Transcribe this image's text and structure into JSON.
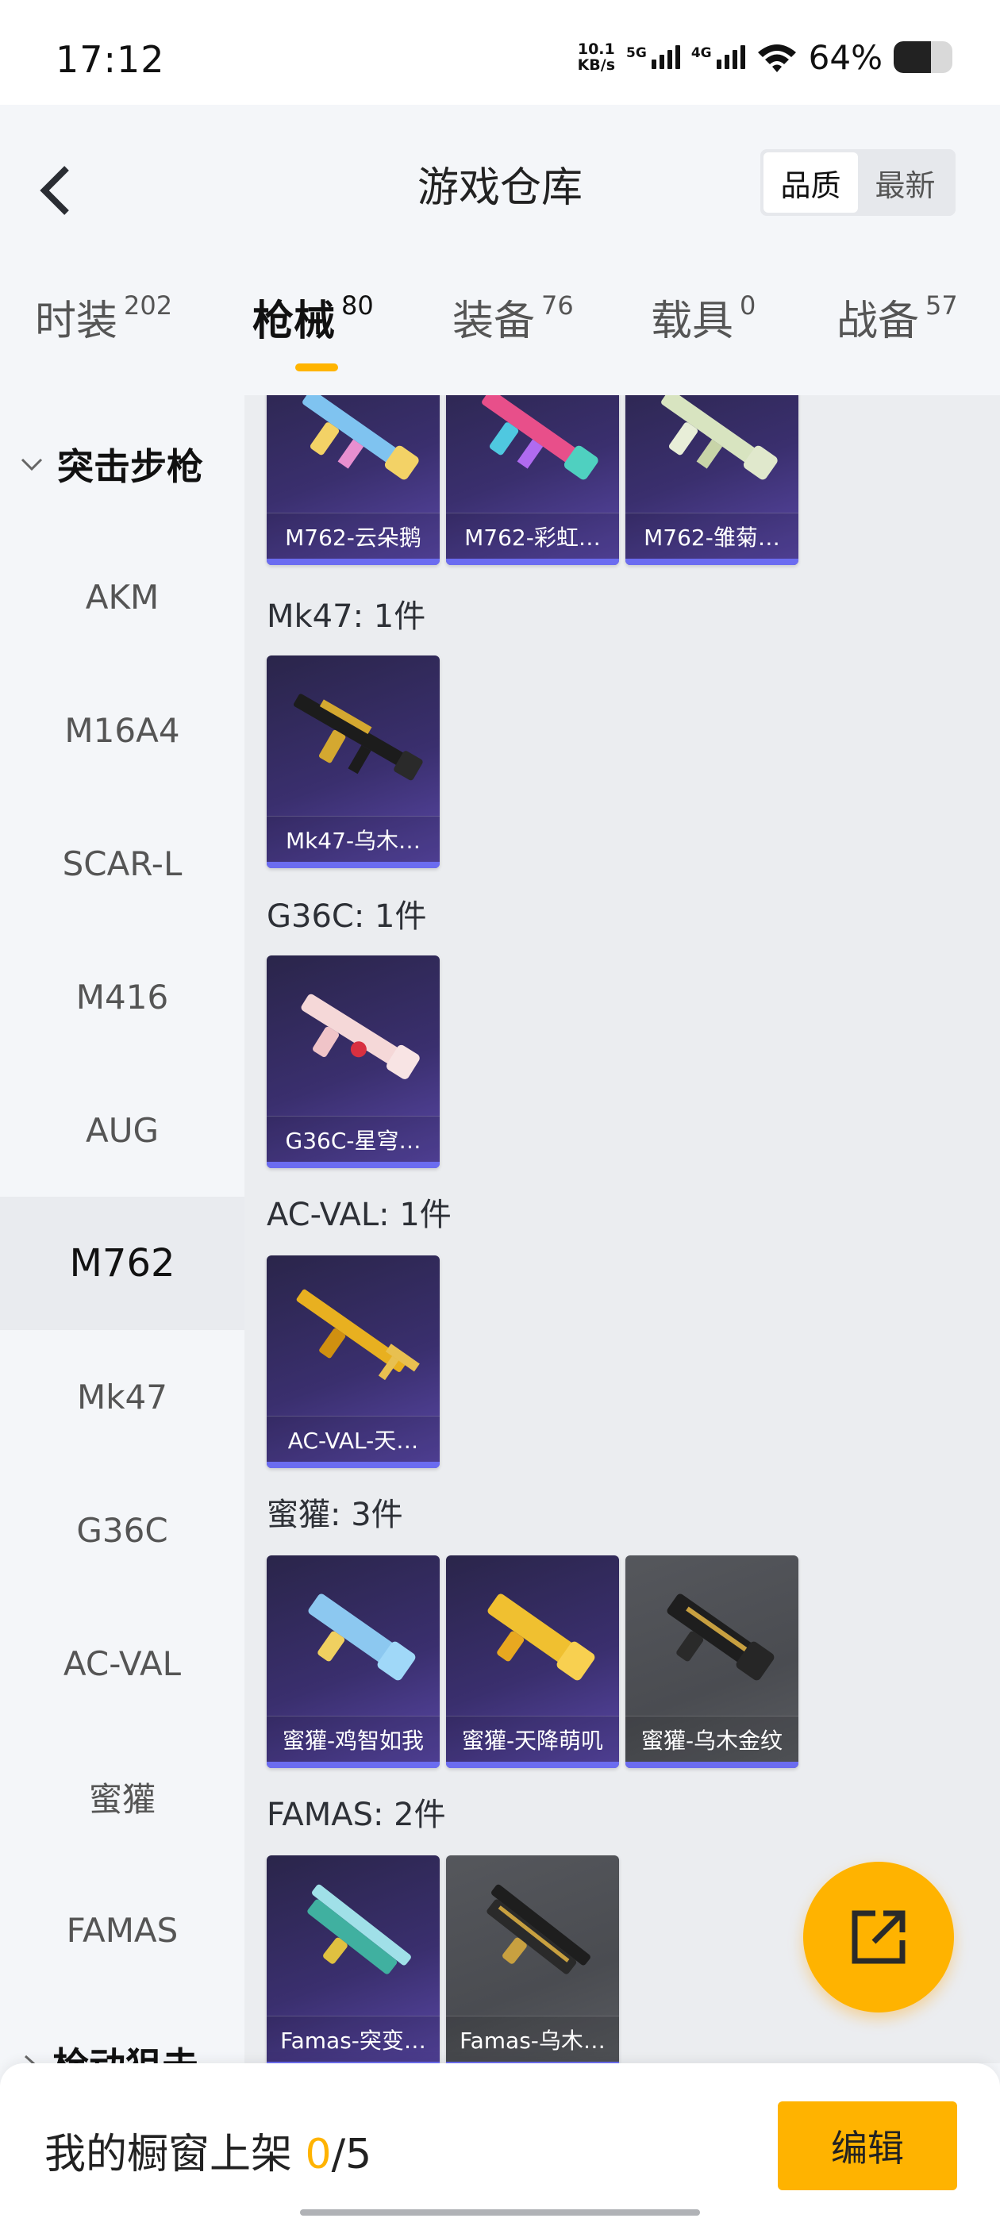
{
  "status_bar": {
    "time": "17:12",
    "net_speed_value": "10.1",
    "net_speed_unit": "KB/s",
    "sim1": "5G",
    "sim2": "4G",
    "battery": "64%",
    "battery_level": 0.64
  },
  "header": {
    "title": "游戏仓库",
    "sort_options": [
      "品质",
      "最新"
    ],
    "sort_selected": "品质"
  },
  "tabs": [
    {
      "label": "时装",
      "count": "202"
    },
    {
      "label": "枪械",
      "count": "80"
    },
    {
      "label": "装备",
      "count": "76"
    },
    {
      "label": "载具",
      "count": "0"
    },
    {
      "label": "战备",
      "count": "57"
    }
  ],
  "sidebar": {
    "category": "突击步枪",
    "items": [
      "AKM",
      "M16A4",
      "SCAR-L",
      "M416",
      "AUG",
      "M762",
      "Mk47",
      "G36C",
      "AC-VAL",
      "蜜獾",
      "FAMAS"
    ],
    "active": "M762",
    "next_category": "栓动狙击"
  },
  "groups": {
    "m762": {
      "items": [
        "M762-云朵鹅",
        "M762-彩虹…",
        "M762-雏菊…"
      ]
    },
    "mk47": {
      "title": "Mk47: 1件",
      "items": [
        "Mk47-乌木…"
      ]
    },
    "g36c": {
      "title": "G36C: 1件",
      "items": [
        "G36C-星穹…"
      ]
    },
    "acval": {
      "title": "AC-VAL: 1件",
      "items": [
        "AC-VAL-天…"
      ]
    },
    "honey": {
      "title": "蜜獾: 3件",
      "items": [
        "蜜獾-鸡智如我",
        "蜜獾-天降萌叽",
        "蜜獾-乌木金纹"
      ]
    },
    "famas": {
      "title": "FAMAS: 2件",
      "items": [
        "Famas-突变…",
        "Famas-乌木…"
      ]
    }
  },
  "bottom": {
    "showcase_label": "我的橱窗上架",
    "showcase_current": "0",
    "showcase_sep": "/",
    "showcase_total": "5",
    "edit_label": "编辑"
  },
  "colors": {
    "accent": "#ffb300",
    "card_purple": "#3a2f6e",
    "card_grey": "#4a4c51",
    "card_underline": "#6b6cf0"
  }
}
